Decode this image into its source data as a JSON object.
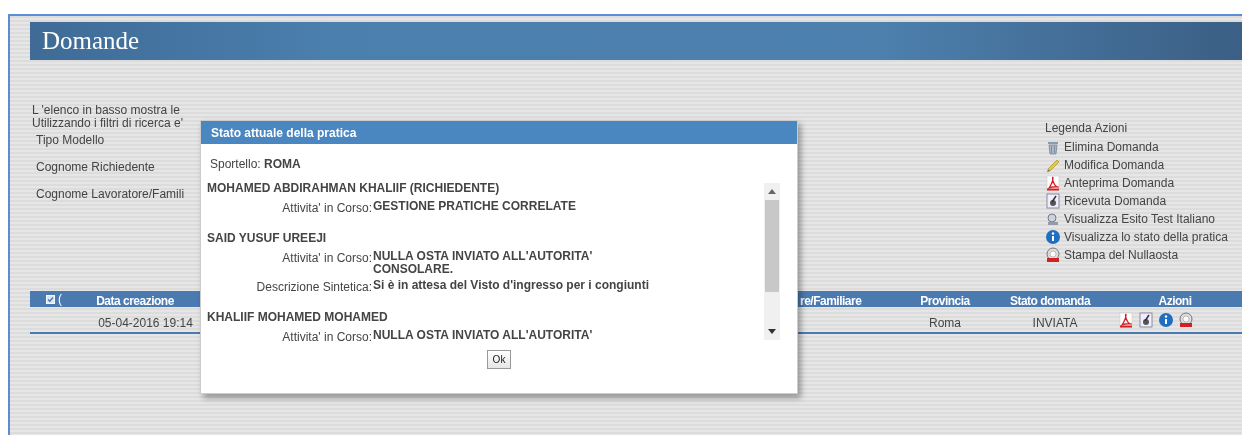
{
  "header": {
    "title": "Domande"
  },
  "intro": [
    "L 'elenco in basso mostra le",
    "Utilizzando i filtri di ricerca e'"
  ],
  "filters": [
    "Tipo Modello",
    "Cognome Richiedente",
    "Cognome Lavoratore/Famili"
  ],
  "legend": {
    "title": "Legenda Azioni",
    "items": [
      {
        "kind": "trash",
        "label": "Elimina Domanda"
      },
      {
        "kind": "pencil",
        "label": "Modifica Domanda"
      },
      {
        "kind": "pdf",
        "label": "Anteprima Domanda"
      },
      {
        "kind": "receipt",
        "label": "Ricevuta Domanda"
      },
      {
        "kind": "test",
        "label": "Visualizza Esito Test Italiano"
      },
      {
        "kind": "info",
        "label": "Visualizza lo stato della pratica"
      },
      {
        "kind": "stamp",
        "label": "Stampa del Nullaosta"
      }
    ]
  },
  "table": {
    "select_all": {
      "checked": true,
      "text": "("
    },
    "columns": [
      "Data creazione",
      "re/Familiare",
      "Provincia",
      "Stato domanda",
      "Azioni"
    ],
    "rows": [
      {
        "data_creazione": "05-04-2016 19:14",
        "provincia": "Roma",
        "stato": "INVIATA",
        "actions": [
          {
            "kind": "pdf"
          },
          {
            "kind": "receipt"
          },
          {
            "kind": "info"
          },
          {
            "kind": "stamp"
          }
        ]
      }
    ]
  },
  "dialog": {
    "title": "Stato attuale della pratica",
    "sportello_label": "Sportello:",
    "sportello_value": "ROMA",
    "entries": [
      {
        "name": "MOHAMED ABDIRAHMAN KHALIIF (RICHIEDENTE)",
        "fields": [
          {
            "label": "Attivita' in Corso:",
            "value": "GESTIONE PRATICHE CORRELATE"
          }
        ]
      },
      {
        "name": "SAID YUSUF UREEJI",
        "fields": [
          {
            "label": "Attivita' in Corso:",
            "value": "NULLA OSTA INVIATO ALL'AUTORITA' CONSOLARE."
          },
          {
            "label": "Descrizione Sintetica:",
            "value": "Si è in attesa del Visto d'ingresso per i congiunti"
          }
        ]
      },
      {
        "name": "KHALIIF MOHAMED MOHAMED",
        "fields": [
          {
            "label": "Attivita' in Corso:",
            "value": "NULLA OSTA INVIATO ALL'AUTORITA'"
          }
        ]
      }
    ],
    "ok_button": "Ok"
  }
}
